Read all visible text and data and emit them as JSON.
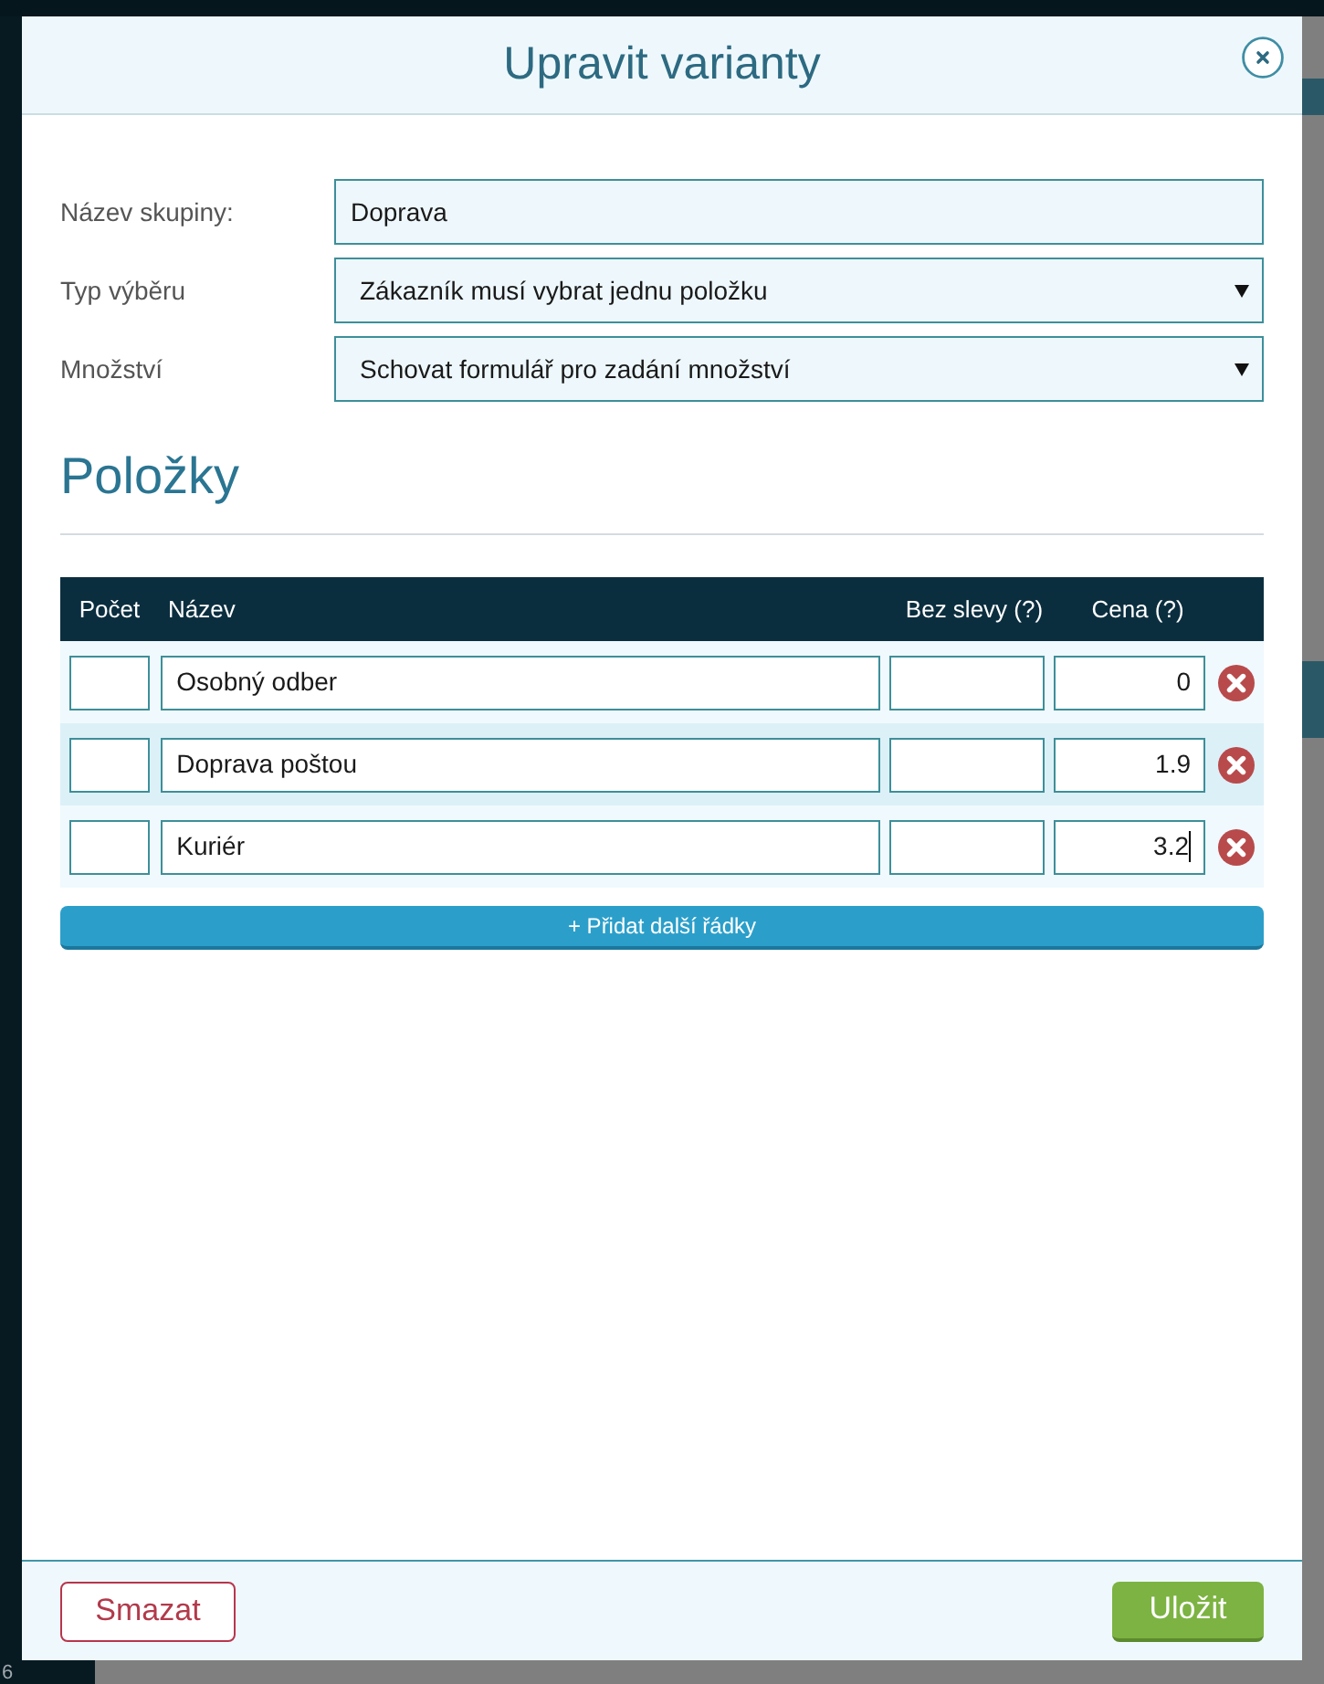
{
  "background": {
    "sidebar_number": "6"
  },
  "dialog": {
    "title": "Upravit varianty"
  },
  "fields": [
    {
      "kind": "text",
      "label": "Název skupiny:",
      "value": "Doprava"
    },
    {
      "kind": "select",
      "label": "Typ výběru",
      "value": "Zákazník musí vybrat jednu položku"
    },
    {
      "kind": "select",
      "label": "Množství",
      "value": "Schovat formulář pro zadání množství"
    }
  ],
  "section": {
    "title": "Položky"
  },
  "table": {
    "columns": [
      "Počet",
      "Název",
      "Bez slevy (?)",
      "Cena (?)"
    ],
    "rows": [
      {
        "name": "Osobný odber",
        "price": "0",
        "price_focused": false
      },
      {
        "name": "Doprava poštou",
        "price": "1.9",
        "price_focused": false
      },
      {
        "name": "Kuriér",
        "price": "3.2",
        "price_focused": true
      }
    ]
  },
  "add_button": "+ Přidat další řádky",
  "footer": {
    "delete_button": "Smazat",
    "save_button": "Uložit"
  }
}
